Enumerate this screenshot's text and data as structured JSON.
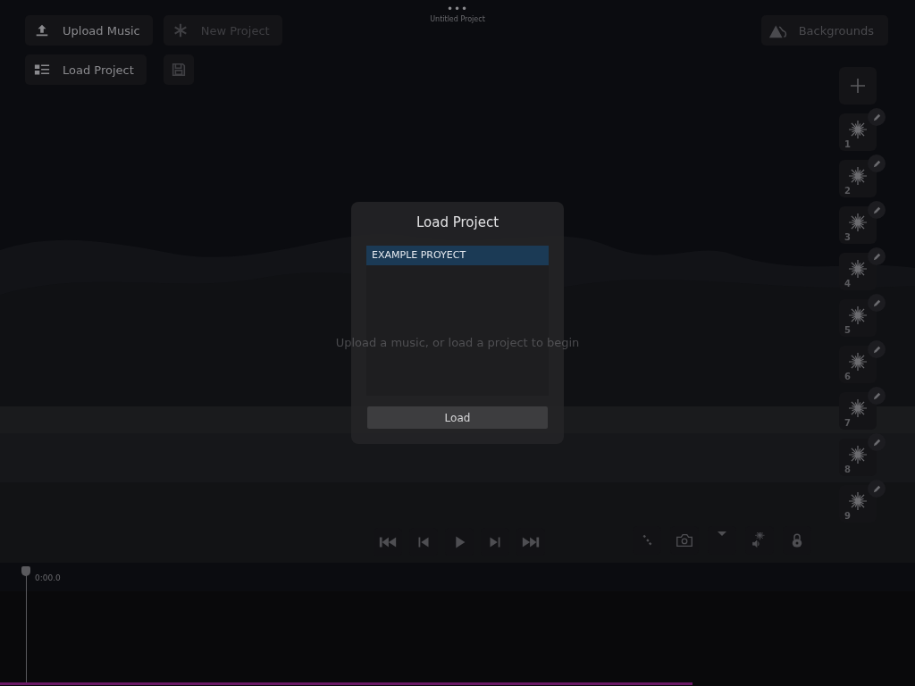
{
  "header": {
    "menu_glyph": "•••",
    "title": "Untitled Project"
  },
  "left_buttons": [
    {
      "kind": "upload",
      "label": "Upload Music",
      "disabled": false
    },
    {
      "kind": "new",
      "label": "New Project",
      "disabled": true
    },
    {
      "kind": "load",
      "label": "Load Project",
      "disabled": false
    },
    {
      "kind": "save",
      "disabled": true
    }
  ],
  "backgrounds_button": {
    "label": "Backgrounds"
  },
  "layers": [
    {
      "number": "1"
    },
    {
      "number": "2"
    },
    {
      "number": "3"
    },
    {
      "number": "4"
    },
    {
      "number": "5"
    },
    {
      "number": "6"
    },
    {
      "number": "7"
    },
    {
      "number": "8"
    },
    {
      "number": "9"
    }
  ],
  "hint": "Upload a music, or load a project to begin",
  "transport": [
    {
      "kind": "rewind"
    },
    {
      "kind": "previous"
    },
    {
      "kind": "play"
    },
    {
      "kind": "next"
    },
    {
      "kind": "forward"
    }
  ],
  "tools": [
    {
      "kind": "dots"
    },
    {
      "kind": "camera"
    },
    {
      "kind": "caret"
    },
    {
      "kind": "sound"
    },
    {
      "kind": "lock"
    }
  ],
  "timeline": {
    "time": "0:00.0",
    "level": 0.757
  },
  "dialog": {
    "title": "Load Project",
    "projects": [
      {
        "name": "EXAMPLE PROYECT",
        "selected": true
      }
    ],
    "button": "Load"
  }
}
